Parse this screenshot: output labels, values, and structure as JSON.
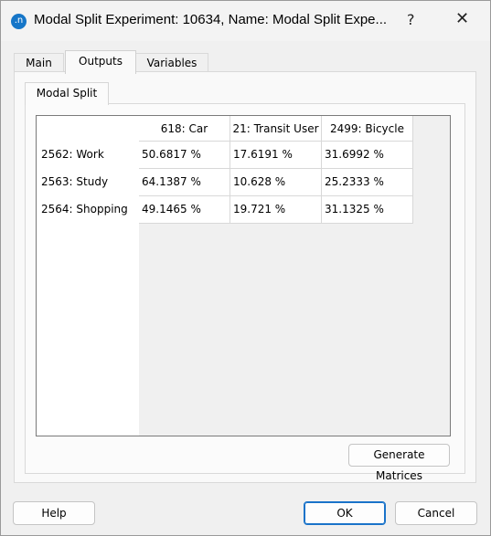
{
  "window": {
    "title": "Modal Split Experiment: 10634, Name: Modal Split Expe...",
    "app_icon": ".n",
    "help_glyph": "?",
    "close_glyph": "✕"
  },
  "tabs": [
    {
      "label": "Main",
      "active": false
    },
    {
      "label": "Outputs",
      "active": true
    },
    {
      "label": "Variables",
      "active": false
    }
  ],
  "subtab": {
    "label": "Modal Split"
  },
  "grid": {
    "columns": [
      "618: Car",
      "21: Transit User",
      "2499: Bicycle"
    ],
    "rows": [
      {
        "label": "2562: Work",
        "cells": [
          "50.6817 %",
          "17.6191 %",
          "31.6992 %"
        ]
      },
      {
        "label": "2563: Study",
        "cells": [
          "64.1387 %",
          "10.628 %",
          "25.2333 %"
        ]
      },
      {
        "label": "2564: Shopping",
        "cells": [
          "49.1465 %",
          "19.721 %",
          "31.1325 %"
        ]
      }
    ]
  },
  "buttons": {
    "generate": "Generate Matrices",
    "help": "Help",
    "ok": "OK",
    "cancel": "Cancel"
  },
  "colors": {
    "accent": "#1a73c9",
    "app_icon": "#1676c8"
  }
}
